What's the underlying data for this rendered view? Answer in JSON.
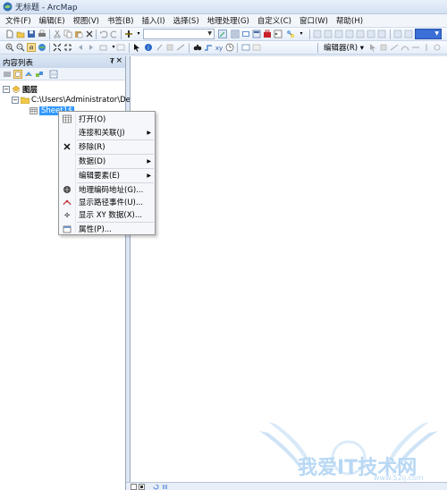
{
  "window": {
    "title": "无标题 - ArcMap"
  },
  "menubar": {
    "items": [
      "文件(F)",
      "编辑(E)",
      "视图(V)",
      "书签(B)",
      "插入(I)",
      "选择(S)",
      "地理处理(G)",
      "自定义(C)",
      "窗口(W)",
      "帮助(H)"
    ]
  },
  "toolbar": {
    "scale_value": "",
    "editor_label": "编辑器(R) ▾"
  },
  "toc": {
    "title": "内容列表",
    "pin": "▾ ×",
    "layers_label": "图层",
    "folder_label": "C:\\Users\\Administrator\\De",
    "sheet_label": "Sheet1$"
  },
  "context_menu": {
    "items": [
      {
        "label": "打开(O)",
        "icon": "table-icon",
        "submenu": false
      },
      {
        "label": "连接和关联(J)",
        "icon": "",
        "submenu": true
      },
      {
        "label": "移除(R)",
        "icon": "remove-icon",
        "submenu": false
      },
      {
        "label": "数据(D)",
        "icon": "",
        "submenu": true
      },
      {
        "label": "编辑要素(E)",
        "icon": "",
        "submenu": true
      },
      {
        "label": "地理编码地址(G)...",
        "icon": "geocode-icon",
        "submenu": false
      },
      {
        "label": "显示路径事件(U)...",
        "icon": "route-event-icon",
        "submenu": false
      },
      {
        "label": "显示 XY 数据(X)...",
        "icon": "xy-data-icon",
        "submenu": false
      },
      {
        "label": "属性(P)...",
        "icon": "properties-icon",
        "submenu": false
      }
    ],
    "submenu_arrow": "▶"
  },
  "watermark": {
    "text": "我爱IT技术网",
    "url": "www.52ij.com"
  },
  "colors": {
    "selection": "#3399ff",
    "accent": "#3399ff"
  }
}
